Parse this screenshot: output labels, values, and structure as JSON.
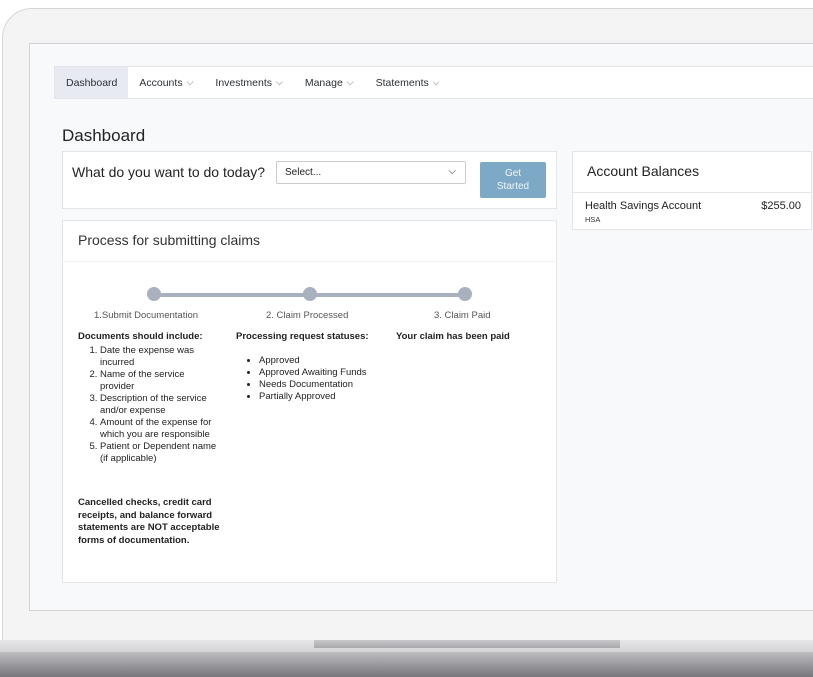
{
  "nav": {
    "items": [
      {
        "label": "Dashboard",
        "active": true,
        "dropdown": false
      },
      {
        "label": "Accounts",
        "active": false,
        "dropdown": true
      },
      {
        "label": "Investments",
        "active": false,
        "dropdown": true
      },
      {
        "label": "Manage",
        "active": false,
        "dropdown": true
      },
      {
        "label": "Statements",
        "active": false,
        "dropdown": true
      }
    ],
    "chevron": "⌵"
  },
  "page_title": "Dashboard",
  "todo": {
    "question": "What do you want to do today?",
    "select_value": "Select...",
    "button_label_line1": "Get",
    "button_label_line2": "Started"
  },
  "balances": {
    "title": "Account Balances",
    "account_name": "Health Savings Account",
    "account_type": "HSA",
    "amount": "$255.00"
  },
  "claims": {
    "title": "Process for submitting claims",
    "steps": [
      "1.Submit Documentation",
      "2. Claim Processed",
      "3. Claim Paid"
    ],
    "documents_heading": "Documents should include:",
    "documents": [
      "Date the expense was incurred",
      "Name of the service provider",
      "Description of the service and/or expense",
      "Amount of the expense for which you are responsible",
      "Patient or Dependent name (if applicable)"
    ],
    "statuses_heading": "Processing request statuses:",
    "statuses": [
      "Approved",
      "Approved Awaiting Funds",
      "Needs Documentation",
      "Partially Approved"
    ],
    "paid_heading": "Your claim has been paid",
    "note": "Cancelled checks, credit card receipts, and balance forward statements are NOT acceptable forms of documentation."
  },
  "colors": {
    "accent_button": "#7da8c6",
    "progress_track": "#a9b1bf",
    "nav_active_bg": "#e7ebf1"
  }
}
